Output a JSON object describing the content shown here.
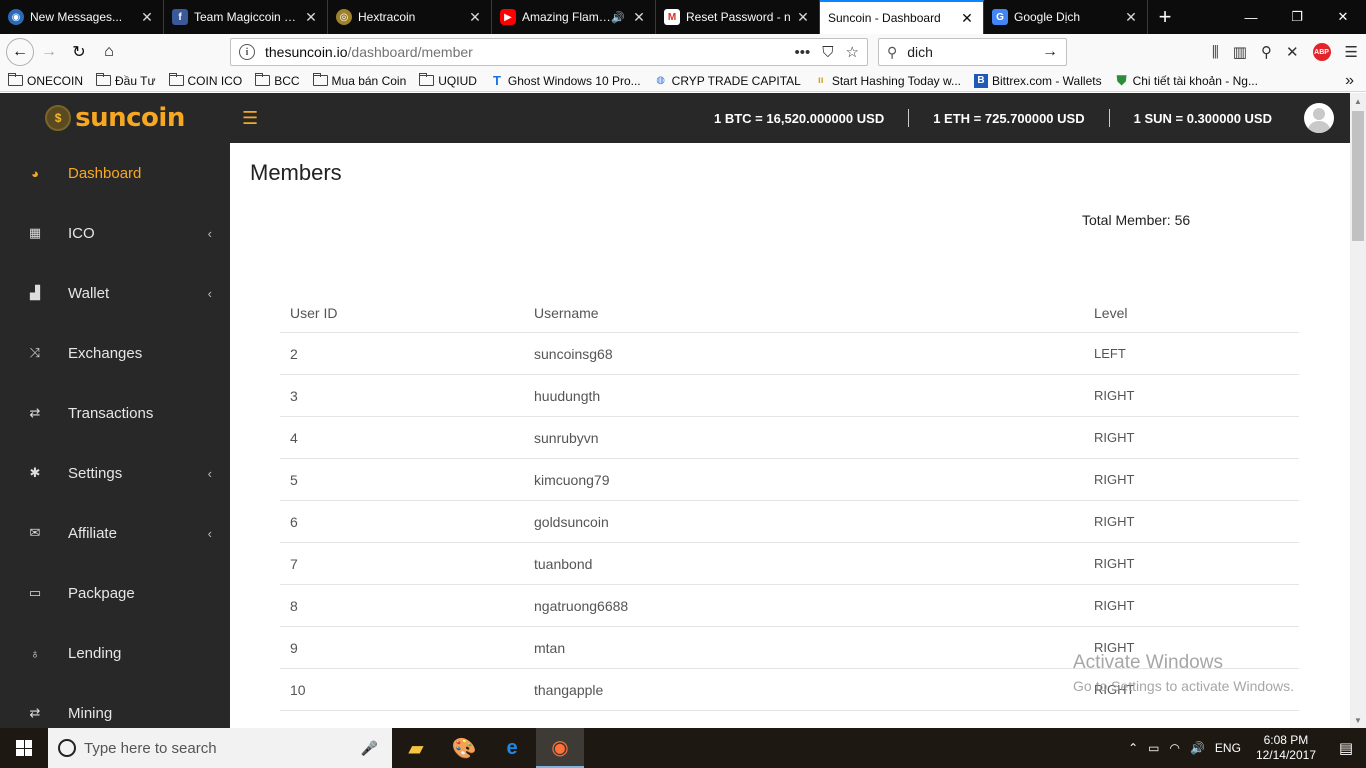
{
  "browser": {
    "tabs": [
      {
        "title": "New Messages...",
        "icon": "chat-icon",
        "color": "#2a6ab8"
      },
      {
        "title": "Team Magiccoin Việ",
        "icon": "facebook-icon",
        "color": "#3b5998"
      },
      {
        "title": "Hextracoin",
        "icon": "coin-icon",
        "color": "#a0812b"
      },
      {
        "title": "Amazing Flamen",
        "icon": "youtube-icon",
        "color": "#ff0000"
      },
      {
        "title": "Reset Password - n",
        "icon": "gmail-icon",
        "color": "#d93025"
      },
      {
        "title": "Suncoin - Dashboard",
        "icon": "none",
        "color": "#ffffff"
      },
      {
        "title": "Google Dịch",
        "icon": "google-translate-icon",
        "color": "#4285f4"
      }
    ],
    "url_host": "thesuncoin.io",
    "url_path": "/dashboard/member",
    "search_value": "dich",
    "bookmarks": [
      {
        "label": "ONECOIN",
        "type": "folder"
      },
      {
        "label": "Đầu Tư",
        "type": "folder"
      },
      {
        "label": "COIN ICO",
        "type": "folder"
      },
      {
        "label": "BCC",
        "type": "folder"
      },
      {
        "label": "Mua bán Coin",
        "type": "folder"
      },
      {
        "label": "UQIUD",
        "type": "folder"
      },
      {
        "label": "Ghost Windows 10 Pro...",
        "type": "link"
      },
      {
        "label": "CRYP TRADE CAPITAL",
        "type": "link"
      },
      {
        "label": "Start Hashing Today w...",
        "type": "link"
      },
      {
        "label": "Bittrex.com - Wallets",
        "type": "link"
      },
      {
        "label": "Chi tiết tài khoản - Ng...",
        "type": "link"
      }
    ]
  },
  "site": {
    "logo_text": "suncoin",
    "logo_symbol": "$",
    "rates": [
      "1 BTC = 16,520.000000 USD",
      "1 ETH = 725.700000 USD",
      "1 SUN = 0.300000 USD"
    ],
    "accent": "#f7a823"
  },
  "sidebar": {
    "items": [
      {
        "label": "Dashboard",
        "icon": "dashboard-icon",
        "active": true,
        "submenu": false
      },
      {
        "label": "ICO",
        "icon": "grid-icon",
        "active": false,
        "submenu": true
      },
      {
        "label": "Wallet",
        "icon": "wallet-icon",
        "active": false,
        "submenu": true
      },
      {
        "label": "Exchanges",
        "icon": "shuffle-icon",
        "active": false,
        "submenu": false
      },
      {
        "label": "Transactions",
        "icon": "retweet-icon",
        "active": false,
        "submenu": false
      },
      {
        "label": "Settings",
        "icon": "gear-icon",
        "active": false,
        "submenu": true
      },
      {
        "label": "Affiliate",
        "icon": "envelope-icon",
        "active": false,
        "submenu": true
      },
      {
        "label": "Packpage",
        "icon": "folder-icon",
        "active": false,
        "submenu": false
      },
      {
        "label": "Lending",
        "icon": "pin-icon",
        "active": false,
        "submenu": false
      },
      {
        "label": "Mining",
        "icon": "retweet-icon",
        "active": false,
        "submenu": false
      }
    ]
  },
  "main": {
    "title": "Members",
    "total_member": "Total Member: 56",
    "columns": [
      "User ID",
      "Username",
      "Level"
    ],
    "rows": [
      [
        "2",
        "suncoinsg68",
        "LEFT"
      ],
      [
        "3",
        "huudungth",
        "RIGHT"
      ],
      [
        "4",
        "sunrubyvn",
        "RIGHT"
      ],
      [
        "5",
        "kimcuong79",
        "RIGHT"
      ],
      [
        "6",
        "goldsuncoin",
        "RIGHT"
      ],
      [
        "7",
        "tuanbond",
        "RIGHT"
      ],
      [
        "8",
        "ngatruong6688",
        "RIGHT"
      ],
      [
        "9",
        "mtan",
        "RIGHT"
      ],
      [
        "10",
        "thangapple",
        "RIGHT"
      ]
    ]
  },
  "watermark": {
    "line1": "Activate Windows",
    "line2": "Go to Settings to activate Windows."
  },
  "taskbar": {
    "search_placeholder": "Type here to search",
    "lang": "ENG",
    "time": "6:08 PM",
    "date": "12/14/2017"
  }
}
